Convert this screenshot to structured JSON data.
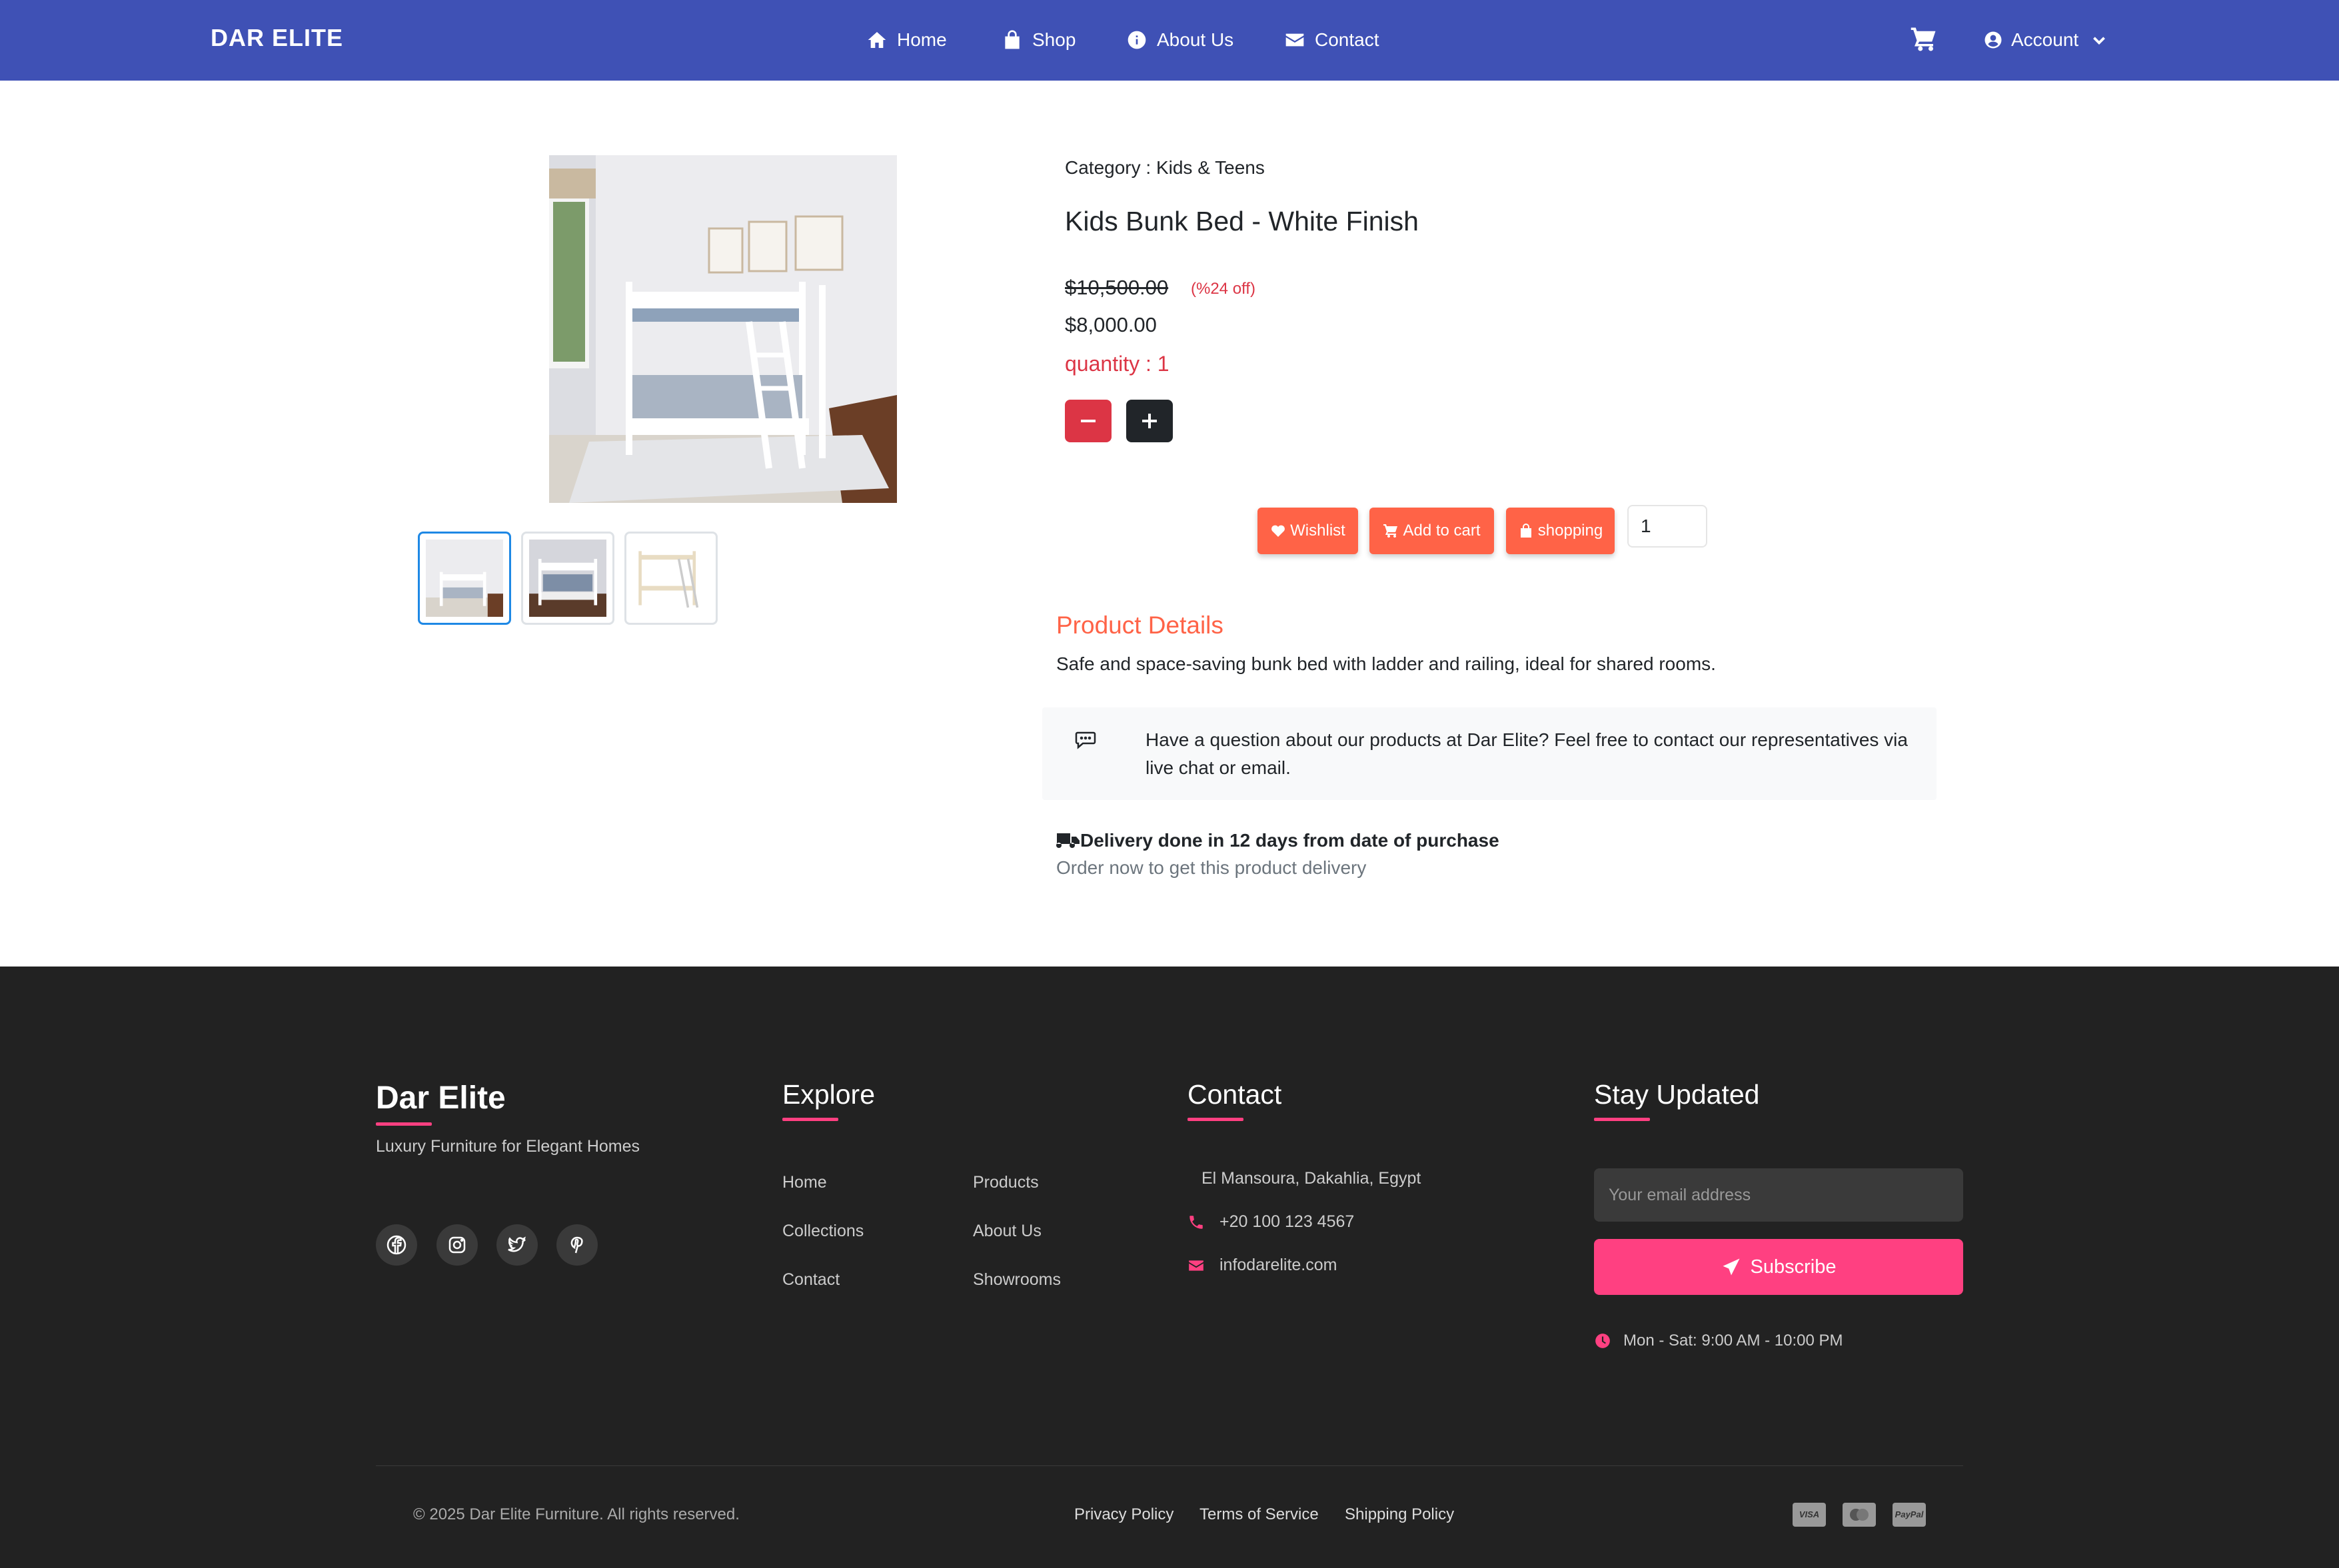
{
  "nav": {
    "brand": "DAR ELITE",
    "items": [
      {
        "label": "Home",
        "icon": "home-icon"
      },
      {
        "label": "Shop",
        "icon": "shopping-bag-icon"
      },
      {
        "label": "About Us",
        "icon": "info-icon"
      },
      {
        "label": "Contact",
        "icon": "envelope-icon"
      }
    ],
    "cart_icon": "cart-icon",
    "account_label": "Account"
  },
  "product": {
    "category": "Category : Kids & Teens",
    "title": "Kids Bunk Bed - White Finish",
    "old_price": "$10,500.00",
    "discount": "(%24 off)",
    "price": "$8,000.00",
    "quantity_label": "quantity : 1",
    "thumbnails": 3,
    "active_thumbnail": 1,
    "actions": {
      "wishlist": "Wishlist",
      "add_to_cart": "Add to cart",
      "shopping": "shopping"
    },
    "quantity_value": "1",
    "details_title": "Product Details",
    "details_text": "Safe and space-saving bunk bed with ladder and railing, ideal for shared rooms.",
    "contact_text": "Have a question about our products at Dar Elite? Feel free to contact our representatives via live chat or email.",
    "delivery_title": "Delivery done in 12 days from date of purchase",
    "delivery_sub": "Order now to get this product delivery"
  },
  "footer": {
    "brand": "Dar Elite",
    "tagline": "Luxury Furniture for Elegant Homes",
    "social": [
      "facebook-icon",
      "instagram-icon",
      "twitter-icon",
      "pinterest-icon"
    ],
    "explore_heading": "Explore",
    "explore_links": [
      "Home",
      "Products",
      "Collections",
      "About Us",
      "Contact",
      "Showrooms"
    ],
    "contact_heading": "Contact",
    "address": "El Mansoura, Dakahlia, Egypt",
    "phone": "+20 100 123 4567",
    "email": "infodarelite.com",
    "stay_heading": "Stay Updated",
    "email_placeholder": "Your email address",
    "subscribe_label": "Subscribe",
    "hours": "Mon - Sat: 9:00 AM - 10:00 PM",
    "copyright": "© 2025 Dar Elite Furniture. All rights reserved.",
    "legal_links": [
      "Privacy Policy",
      "Terms of Service",
      "Shipping Policy"
    ],
    "payment_icons": [
      {
        "icon": "visa-icon",
        "text": "VISA"
      },
      {
        "icon": "mastercard-icon",
        "text": ""
      },
      {
        "icon": "paypal-icon",
        "text": "PayPal"
      }
    ],
    "accent_color": "#ff4081"
  },
  "colors": {
    "navbar": "#3f51b5",
    "action_button": "#ff6347",
    "minus_button": "#dc3545",
    "plus_button": "#212529",
    "footer_bg": "#222222"
  }
}
